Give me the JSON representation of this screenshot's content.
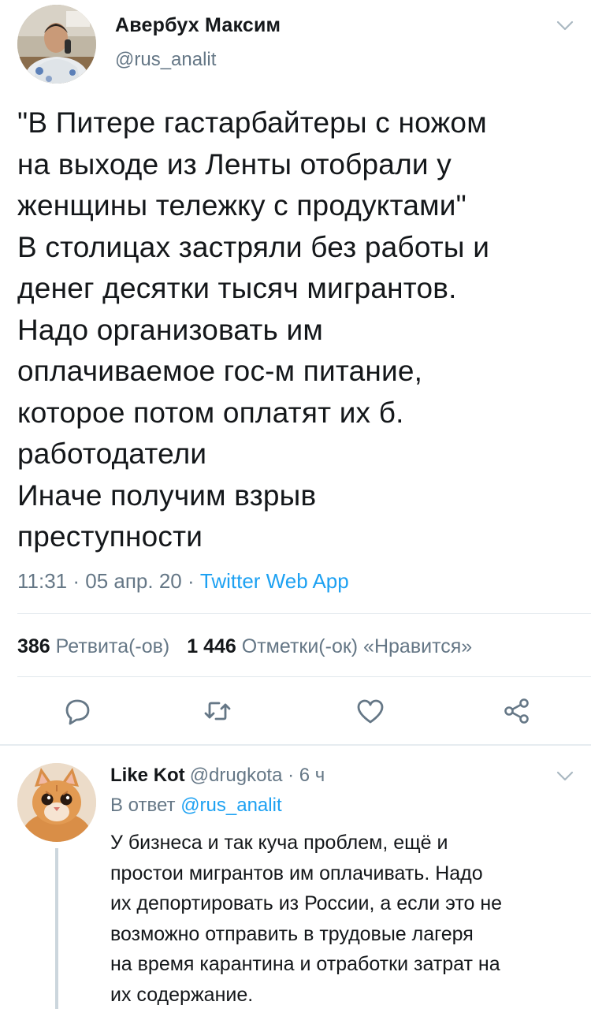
{
  "tweet": {
    "author_name": "Авербух Максим",
    "author_handle": "@rus_analit",
    "text": "\"В Питере гастарбайтеры с ножом\nна выходе из Ленты отобрали у\nженщины тележку с продуктами\"\nВ столицах застряли без работы и\nденег десятки тысяч мигрантов.\nНадо организовать им\nоплачиваемое гос-м питание,\nкоторое потом оплатят их б.\nработодатели\nИначе получим взрыв\nпреступности",
    "time": "11:31",
    "date": "05 апр. 20",
    "separator": " · ",
    "source": "Twitter Web App",
    "retweets_count": "386",
    "retweets_label": "Ретвита(-ов)",
    "likes_count": "1 446",
    "likes_label": "Отметки(-ок) «Нравится»",
    "actions": {
      "reply_icon": "reply-bubble-icon",
      "retweet_icon": "retweet-arrows-icon",
      "like_icon": "heart-icon",
      "share_icon": "share-nodes-icon"
    }
  },
  "reply": {
    "author_name": "Like Kot",
    "author_handle": "@drugkota",
    "age": "6 ч",
    "separator": " · ",
    "reply_to_label": "В ответ",
    "reply_to_mention": "@rus_analit",
    "text": "У бизнеса и так куча проблем, ещё и\nпростои мигрантов им оплачивать. Надо\nих депортировать из России, а если это не\nвозможно отправить в трудовые лагеря\nна время карантина и отработки затрат на\nих содержание."
  },
  "colors": {
    "text": "#14171a",
    "secondary": "#657786",
    "accent": "#1da1f2",
    "divider": "#e1e8ed"
  }
}
